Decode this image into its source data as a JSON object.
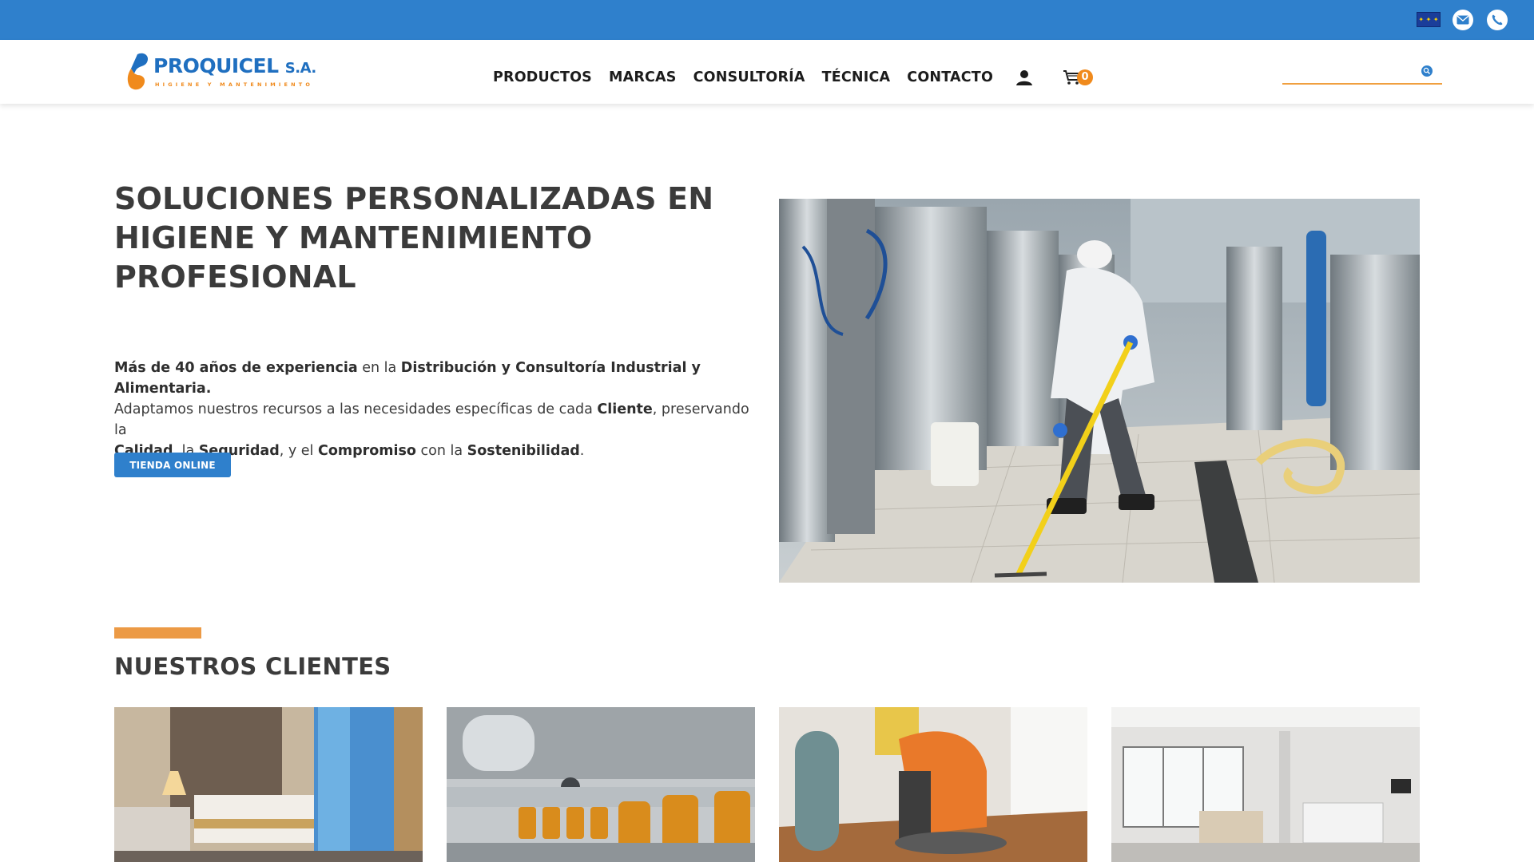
{
  "topbar": {
    "color": "#2f80cc",
    "icons": [
      "eu-flag-icon",
      "mail-icon",
      "phone-icon"
    ]
  },
  "header": {
    "logo": {
      "brand": "PROQUICEL",
      "suffix": "S.A.",
      "tagline": "HIGIENE Y MANTENIMIENTO"
    },
    "nav": [
      {
        "label": "PRODUCTOS"
      },
      {
        "label": "MARCAS"
      },
      {
        "label": "CONSULTORÍA"
      },
      {
        "label": "TÉCNICA"
      },
      {
        "label": "CONTACTO"
      }
    ],
    "cart_count": "0",
    "search": {
      "value": "",
      "placeholder": ""
    }
  },
  "hero": {
    "title_lines": [
      "SOLUCIONES PERSONALIZADAS EN",
      "HIGIENE Y MANTENIMIENTO",
      "PROFESIONAL"
    ],
    "description": {
      "p1_bold": "Más de 40 años de experiencia",
      "p1_text": " en la ",
      "p1_bold2": "Distribución y Consultoría Industrial y Alimentaria.",
      "p2_text": "Adaptamos nuestros recursos a las necesidades específicas de cada ",
      "p2_bold": "Cliente",
      "p2_text2": ", preservando la",
      "p3_bold": "Calidad",
      "p3_text": ". la ",
      "p3_bold2": "Seguridad",
      "p3_text2": ", y el ",
      "p3_bold3": "Compromiso",
      "p3_text3": " con la ",
      "p3_bold4": "Sostenibilidad",
      "p3_text4": "."
    },
    "cta_label": "TIENDA ONLINE"
  },
  "clients": {
    "title_light": "NUESTROS",
    "title_bold": "CLIENTES",
    "accent_color": "#ec9a45",
    "cards": [
      "hotel-room-photo",
      "bottling-line-photo",
      "floor-scrubber-photo",
      "hospital-room-photo"
    ]
  },
  "colors": {
    "primary": "#2f80cc",
    "accent": "#f08a1c",
    "text": "#3b3b3b"
  }
}
